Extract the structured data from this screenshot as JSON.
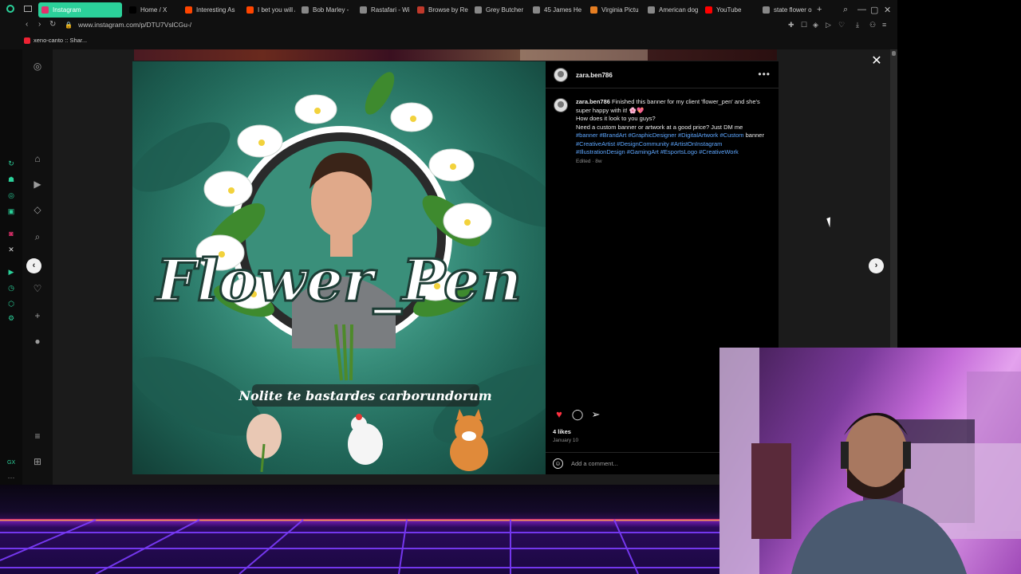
{
  "browser": {
    "tabs": [
      {
        "label": "Instagram",
        "active": true,
        "color": "#e1306c"
      },
      {
        "label": "Home / X",
        "active": false,
        "color": "#000000"
      },
      {
        "label": "Interesting As",
        "active": false,
        "color": "#ff4500"
      },
      {
        "label": "I bet you will /",
        "active": false,
        "color": "#ff4500"
      },
      {
        "label": "Bob Marley - ",
        "active": false,
        "color": "#888888"
      },
      {
        "label": "Rastafari - Wi",
        "active": false,
        "color": "#888888"
      },
      {
        "label": "Browse by Re",
        "active": false,
        "color": "#c0392b"
      },
      {
        "label": "Grey Butcher",
        "active": false,
        "color": "#888888"
      },
      {
        "label": "45 James He",
        "active": false,
        "color": "#888888"
      },
      {
        "label": "Virginia Pictu",
        "active": false,
        "color": "#e67e22"
      },
      {
        "label": "American dog",
        "active": false,
        "color": "#888888"
      },
      {
        "label": "YouTube",
        "active": false,
        "color": "#ff0000"
      },
      {
        "label": "state flower o",
        "active": false,
        "color": "#888888"
      }
    ],
    "new_tab": "+",
    "url": "www.instagram.com/p/DTU7VslCGu-/",
    "bookmark": "xeno-canto :: Shar..."
  },
  "post": {
    "username": "zara.ben786",
    "caption_text": "Finished this banner for my client 'flower_pen' and she's super happy with it! 🌸💖",
    "caption_line2": "How does it look to you guys?",
    "caption_line3": "Need a custom banner or artwork at a good price? Just DM me",
    "hashtags_a": "#banner #BrandArt #GraphicDesigner #DigitalArtwork #Custom",
    "hashtags_mid": "banner",
    "hashtags_b": "#CreativeArtist #DesignCommunity #ArtistOnInstagram #IllustrationDesign #GamingArt #EsportsLogo #CreativeWork",
    "edited": "Edited · 8w",
    "likes": "4 likes",
    "date": "January 10",
    "comment_placeholder": "Add a comment...",
    "image_title": "Flower_Pen",
    "image_motto": "Nolite te bastardes carborundorum"
  },
  "colors": {
    "like": "#ff3040",
    "accent_tab": "#2bd19a",
    "hashtag": "#5ea7ff"
  }
}
